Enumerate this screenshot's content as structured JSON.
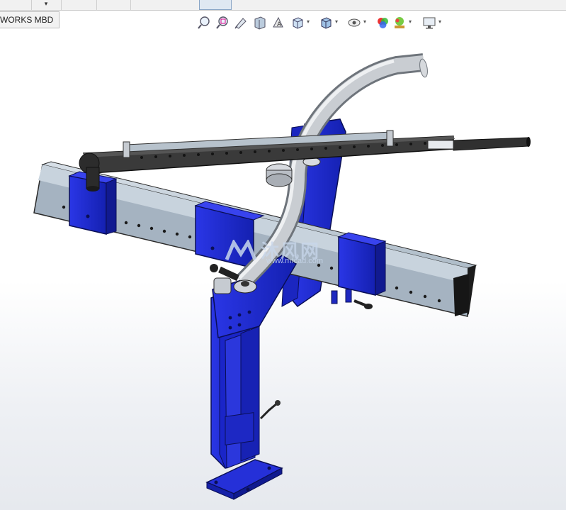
{
  "window": {
    "tabs": [
      {
        "label": ""
      },
      {
        "label": "▾"
      },
      {
        "label": ""
      },
      {
        "label": ""
      },
      {
        "label": ""
      }
    ],
    "mbd_tab_label": "WORKS MBD"
  },
  "heads_up_toolbar": {
    "items": [
      {
        "icon": "zoom-to-fit-icon"
      },
      {
        "icon": "zoom-to-area-icon"
      },
      {
        "icon": "previous-view-icon"
      },
      {
        "icon": "section-view-icon"
      },
      {
        "icon": "dynamic-annotation-views-icon"
      },
      {
        "icon": "view-orientation-icon",
        "dropdown": true
      },
      {
        "icon": "display-style-icon",
        "dropdown": true
      },
      {
        "icon": "hide-show-items-icon",
        "dropdown": true
      },
      {
        "icon": "edit-appearance-icon"
      },
      {
        "icon": "apply-scene-icon",
        "dropdown": true
      },
      {
        "icon": "view-settings-icon",
        "dropdown": true
      }
    ]
  },
  "watermark": {
    "text": "沐风网",
    "url": "www.mfcad.com"
  },
  "colors": {
    "frame_blue": "#1f2bd6",
    "tube_silver": "#c5d0da",
    "handle_black": "#2b2b2b",
    "pipe_gray": "#b8bcc2"
  }
}
